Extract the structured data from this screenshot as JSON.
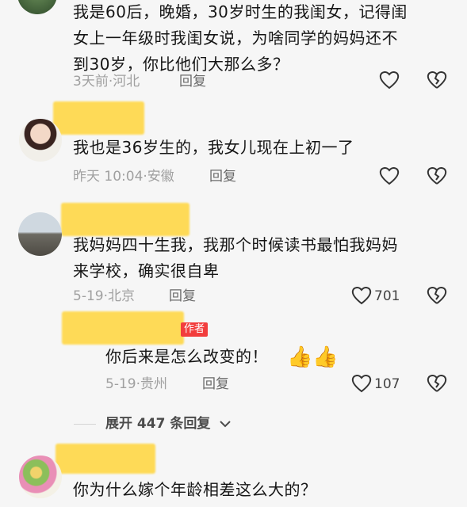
{
  "comments": [
    {
      "text_lines": [
        "我是60后，晚婚，30岁时生的我闺女，记得闺",
        "女上一年级时我闺女说，为啥同学的妈妈还不",
        "到30岁，你比他们大那么多？"
      ],
      "meta": "3天前·河北",
      "reply_label": "回复",
      "likes": "",
      "like_icon": "heart-outline-icon",
      "dislike_icon": "broken-heart-icon"
    },
    {
      "text_lines": [
        "我也是36岁生的，我女儿现在上初一了"
      ],
      "meta": "昨天 10:04·安徽",
      "reply_label": "回复",
      "likes": "",
      "like_icon": "heart-outline-icon",
      "dislike_icon": "broken-heart-icon"
    },
    {
      "text_lines": [
        "我妈妈四十生我，我那个时候读书最怕我妈妈",
        "来学校，确实很自卑"
      ],
      "meta": "5-19·北京",
      "reply_label": "回复",
      "likes": "701",
      "like_icon": "heart-outline-icon",
      "dislike_icon": "broken-heart-icon"
    }
  ],
  "sub_reply": {
    "author_tag": "作者",
    "text": "你后来是怎么改变的！",
    "emoji": "👍👍",
    "meta": "5-19·贵州",
    "reply_label": "回复",
    "likes": "107"
  },
  "expand": {
    "label": "展开 447 条回复",
    "chevron": "chevron-down-icon"
  },
  "last_comment": {
    "text": "你为什么嫁个年龄相差这么大的？"
  },
  "colors": {
    "name_blur": "#ffd84a",
    "author_tag_bg": "#f23d3d",
    "meta": "#a0a0a0"
  }
}
